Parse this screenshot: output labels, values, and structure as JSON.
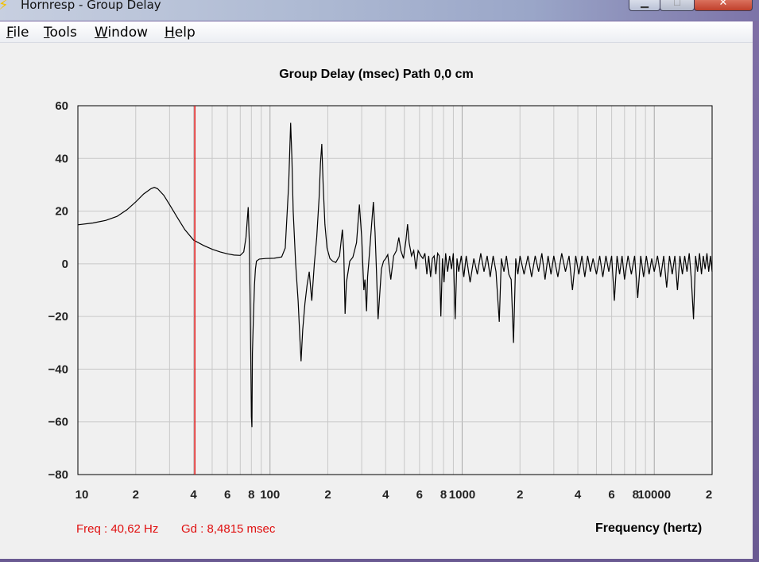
{
  "window": {
    "title": "Hornresp - Group Delay",
    "controls": {
      "minimize": "▁",
      "maximize": "□",
      "close": "✕"
    }
  },
  "menu": {
    "items": [
      {
        "key": "F",
        "rest": "ile"
      },
      {
        "key": "T",
        "rest": "ools"
      },
      {
        "key": "W",
        "rest": "indow"
      },
      {
        "key": "H",
        "rest": "elp"
      }
    ]
  },
  "readout": {
    "freq": "Freq : 40,62 Hz",
    "gd": "Gd : 8,4815 msec"
  },
  "colors": {
    "cursor": "#e01010",
    "curve": "#000000",
    "grid": "#c8c8c8",
    "grid_major": "#a8a8a8"
  },
  "chart_data": {
    "type": "line",
    "title": "Group Delay (msec)    Path 0,0 cm",
    "xlabel": "Frequency (hertz)",
    "ylabel": "",
    "x_scale": "log",
    "xlim": [
      10,
      20000
    ],
    "ylim": [
      -80,
      60
    ],
    "grid": true,
    "x_ticks": [
      {
        "value": 10,
        "label": "10"
      },
      {
        "value": 20,
        "label": "2"
      },
      {
        "value": 40,
        "label": "4"
      },
      {
        "value": 60,
        "label": "6"
      },
      {
        "value": 80,
        "label": "8"
      },
      {
        "value": 100,
        "label": "100"
      },
      {
        "value": 200,
        "label": "2"
      },
      {
        "value": 400,
        "label": "4"
      },
      {
        "value": 600,
        "label": "6"
      },
      {
        "value": 800,
        "label": "8"
      },
      {
        "value": 1000,
        "label": "1000"
      },
      {
        "value": 2000,
        "label": "2"
      },
      {
        "value": 4000,
        "label": "4"
      },
      {
        "value": 6000,
        "label": "6"
      },
      {
        "value": 8000,
        "label": "8"
      },
      {
        "value": 10000,
        "label": "10000"
      },
      {
        "value": 20000,
        "label": "2"
      }
    ],
    "y_ticks": [
      60,
      40,
      20,
      0,
      -20,
      -40,
      -60,
      -80
    ],
    "cursor_x": 40.62,
    "series": [
      {
        "points": [
          [
            10,
            14.8
          ],
          [
            12,
            15.5
          ],
          [
            14,
            16.5
          ],
          [
            16,
            18
          ],
          [
            18,
            20.5
          ],
          [
            20,
            23.5
          ],
          [
            22,
            26.5
          ],
          [
            24,
            28.5
          ],
          [
            25,
            29
          ],
          [
            26,
            28.5
          ],
          [
            28,
            26
          ],
          [
            30,
            22.5
          ],
          [
            33,
            17.5
          ],
          [
            36,
            13
          ],
          [
            40,
            9
          ],
          [
            45,
            7
          ],
          [
            50,
            5.5
          ],
          [
            55,
            4.5
          ],
          [
            60,
            3.8
          ],
          [
            65,
            3.3
          ],
          [
            70,
            3.2
          ],
          [
            73,
            4.5
          ],
          [
            75,
            10
          ],
          [
            77,
            21.5
          ],
          [
            78,
            8
          ],
          [
            79,
            -20
          ],
          [
            80,
            -58
          ],
          [
            80.5,
            -62
          ],
          [
            81,
            -34
          ],
          [
            82,
            -20
          ],
          [
            83,
            -8
          ],
          [
            84,
            -2
          ],
          [
            85,
            1
          ],
          [
            88,
            1.8
          ],
          [
            95,
            2
          ],
          [
            105,
            2.1
          ],
          [
            115,
            2.6
          ],
          [
            120,
            6
          ],
          [
            125,
            30
          ],
          [
            128,
            53.5
          ],
          [
            130,
            40
          ],
          [
            132,
            20
          ],
          [
            136,
            0
          ],
          [
            140,
            -14
          ],
          [
            143,
            -28
          ],
          [
            145,
            -37
          ],
          [
            148,
            -25
          ],
          [
            152,
            -15
          ],
          [
            156,
            -8
          ],
          [
            160,
            -3
          ],
          [
            165,
            -14
          ],
          [
            170,
            0
          ],
          [
            175,
            10
          ],
          [
            180,
            25
          ],
          [
            183,
            38
          ],
          [
            186,
            45.5
          ],
          [
            189,
            30
          ],
          [
            193,
            15
          ],
          [
            198,
            6
          ],
          [
            205,
            2
          ],
          [
            212,
            1
          ],
          [
            220,
            0.5
          ],
          [
            230,
            3
          ],
          [
            238,
            13
          ],
          [
            242,
            5
          ],
          [
            246,
            -19
          ],
          [
            250,
            -7
          ],
          [
            260,
            1
          ],
          [
            270,
            2.5
          ],
          [
            282,
            8
          ],
          [
            292,
            22.5
          ],
          [
            300,
            10
          ],
          [
            308,
            -10
          ],
          [
            312,
            -6
          ],
          [
            318,
            -18
          ],
          [
            322,
            -5
          ],
          [
            330,
            5
          ],
          [
            338,
            15
          ],
          [
            345,
            23.5
          ],
          [
            352,
            12
          ],
          [
            358,
            -2
          ],
          [
            365,
            -21
          ],
          [
            372,
            -12
          ],
          [
            380,
            -2
          ],
          [
            390,
            1
          ],
          [
            400,
            2
          ],
          [
            410,
            3.5
          ],
          [
            425,
            -6
          ],
          [
            440,
            3
          ],
          [
            455,
            5
          ],
          [
            468,
            10
          ],
          [
            480,
            5
          ],
          [
            495,
            2
          ],
          [
            510,
            9
          ],
          [
            520,
            15
          ],
          [
            530,
            8
          ],
          [
            545,
            3
          ],
          [
            560,
            5
          ],
          [
            575,
            -2
          ],
          [
            590,
            5
          ],
          [
            610,
            3
          ],
          [
            625,
            2
          ],
          [
            640,
            4
          ],
          [
            655,
            -4
          ],
          [
            670,
            3
          ],
          [
            685,
            -5
          ],
          [
            700,
            2
          ],
          [
            715,
            3
          ],
          [
            730,
            -4
          ],
          [
            745,
            4
          ],
          [
            760,
            3
          ],
          [
            775,
            -20
          ],
          [
            790,
            2
          ],
          [
            805,
            -7
          ],
          [
            820,
            4
          ],
          [
            840,
            -3
          ],
          [
            860,
            3
          ],
          [
            880,
            -2
          ],
          [
            900,
            4
          ],
          [
            920,
            -21
          ],
          [
            940,
            2
          ],
          [
            960,
            -3
          ],
          [
            990,
            3
          ],
          [
            1020,
            -5
          ],
          [
            1050,
            3
          ],
          [
            1100,
            -7
          ],
          [
            1150,
            2
          ],
          [
            1200,
            -4
          ],
          [
            1250,
            4
          ],
          [
            1300,
            -3
          ],
          [
            1350,
            3
          ],
          [
            1400,
            -5
          ],
          [
            1450,
            3
          ],
          [
            1500,
            -3
          ],
          [
            1560,
            -22
          ],
          [
            1600,
            2
          ],
          [
            1650,
            -3
          ],
          [
            1700,
            3
          ],
          [
            1750,
            -4
          ],
          [
            1800,
            -6
          ],
          [
            1850,
            -30
          ],
          [
            1900,
            2
          ],
          [
            1950,
            -4
          ],
          [
            2000,
            3
          ],
          [
            2100,
            -4
          ],
          [
            2200,
            3
          ],
          [
            2300,
            -5
          ],
          [
            2400,
            3
          ],
          [
            2500,
            -3
          ],
          [
            2600,
            4
          ],
          [
            2700,
            -6
          ],
          [
            2800,
            3
          ],
          [
            2900,
            -4
          ],
          [
            3000,
            3
          ],
          [
            3150,
            -5
          ],
          [
            3300,
            4
          ],
          [
            3450,
            -3
          ],
          [
            3600,
            3
          ],
          [
            3750,
            -10
          ],
          [
            3900,
            3
          ],
          [
            4050,
            -4
          ],
          [
            4200,
            3
          ],
          [
            4350,
            -5
          ],
          [
            4500,
            3
          ],
          [
            4650,
            -3
          ],
          [
            4800,
            2
          ],
          [
            5000,
            -4
          ],
          [
            5200,
            3
          ],
          [
            5400,
            -5
          ],
          [
            5600,
            3
          ],
          [
            5800,
            -3
          ],
          [
            6000,
            3
          ],
          [
            6200,
            -14
          ],
          [
            6400,
            3
          ],
          [
            6600,
            -4
          ],
          [
            6800,
            3
          ],
          [
            7000,
            -6
          ],
          [
            7300,
            3
          ],
          [
            7600,
            -4
          ],
          [
            7900,
            3
          ],
          [
            8200,
            -13
          ],
          [
            8500,
            3
          ],
          [
            8800,
            -5
          ],
          [
            9100,
            3
          ],
          [
            9400,
            -4
          ],
          [
            9700,
            2
          ],
          [
            10000,
            -3
          ],
          [
            10400,
            3
          ],
          [
            10800,
            -5
          ],
          [
            11200,
            3
          ],
          [
            11600,
            -9
          ],
          [
            12000,
            3
          ],
          [
            12400,
            -4
          ],
          [
            12800,
            3
          ],
          [
            13200,
            -10
          ],
          [
            13600,
            3
          ],
          [
            14000,
            -4
          ],
          [
            14400,
            3
          ],
          [
            14800,
            -3
          ],
          [
            15200,
            4
          ],
          [
            15600,
            -6
          ],
          [
            16000,
            -21
          ],
          [
            16400,
            3
          ],
          [
            16800,
            -3
          ],
          [
            17200,
            4
          ],
          [
            17600,
            -4
          ],
          [
            18000,
            3
          ],
          [
            18400,
            -2
          ],
          [
            18800,
            4
          ],
          [
            19200,
            -3
          ],
          [
            19600,
            3
          ],
          [
            20000,
            -3
          ]
        ]
      }
    ]
  }
}
